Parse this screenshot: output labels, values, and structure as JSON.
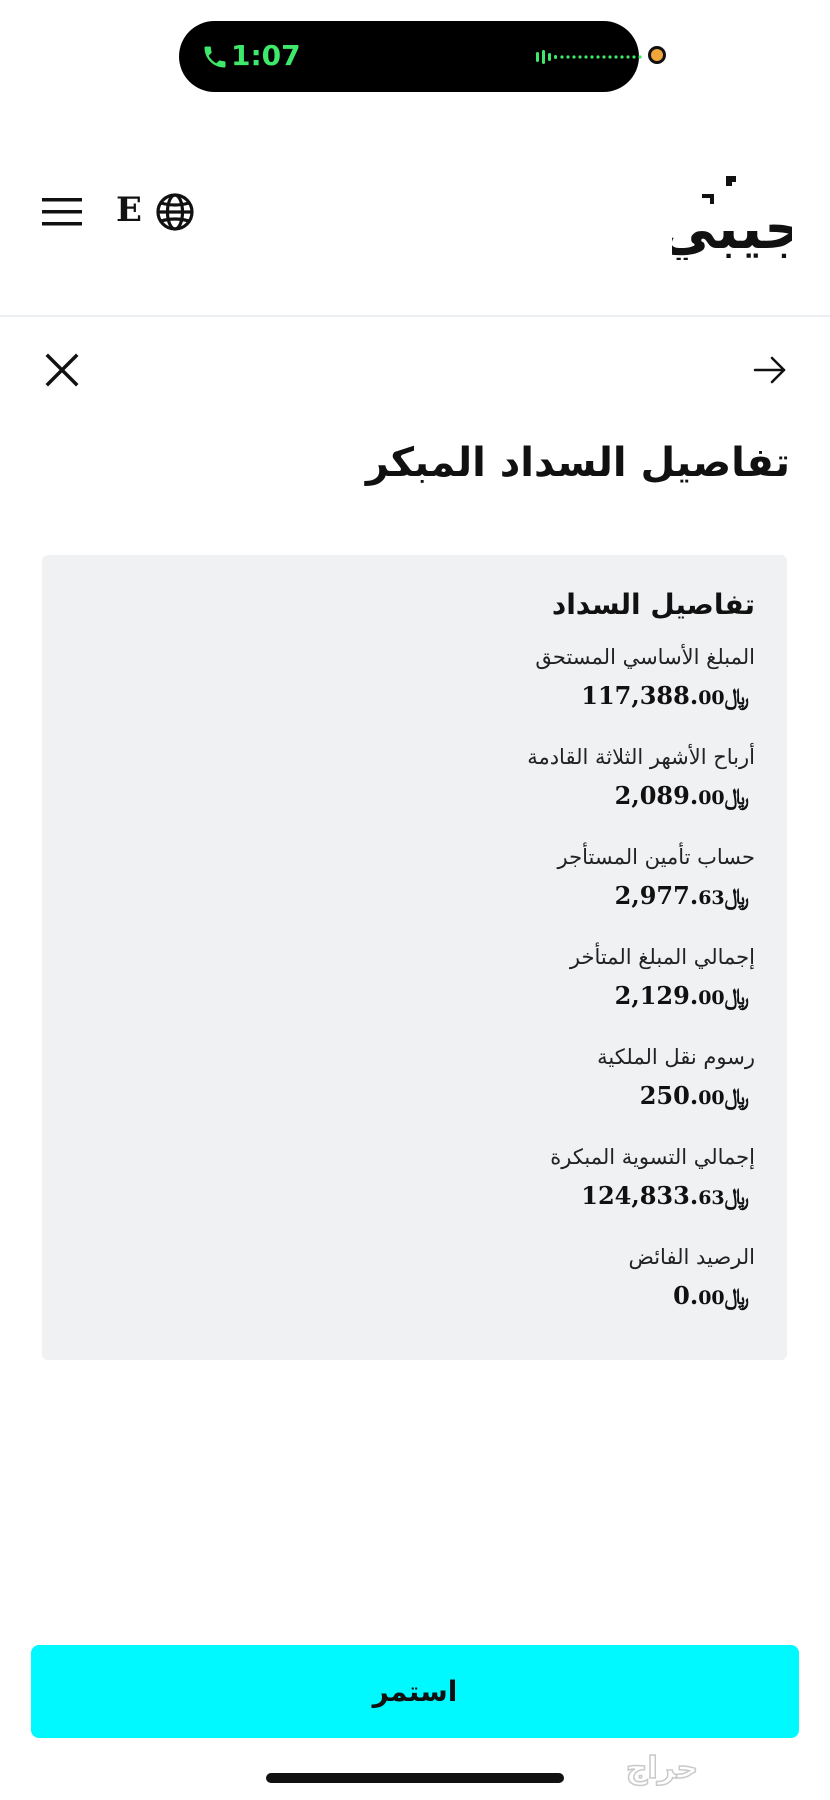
{
  "status_bar": {
    "time": "1:07"
  },
  "header": {
    "lang_letter": "E",
    "logo_text": "جيبي"
  },
  "page": {
    "title": "تفاصيل السداد المبكر"
  },
  "card": {
    "title": "تفاصيل السداد",
    "currency_symbol": "﷼",
    "items": [
      {
        "label": "المبلغ الأساسي المستحق",
        "whole": "117,388.",
        "dec": "00"
      },
      {
        "label": "أرباح الأشهر الثلاثة القادمة",
        "whole": "2,089.",
        "dec": "00"
      },
      {
        "label": "حساب تأمين المستأجر",
        "whole": "2,977.",
        "dec": "63"
      },
      {
        "label": "إجمالي المبلغ المتأخر",
        "whole": "2,129.",
        "dec": "00"
      },
      {
        "label": "رسوم نقل الملكية",
        "whole": "250.",
        "dec": "00"
      },
      {
        "label": "إجمالي التسوية المبكرة",
        "whole": "124,833.",
        "dec": "63"
      },
      {
        "label": "الرصيد الفائض",
        "whole": "0.",
        "dec": "00"
      }
    ]
  },
  "actions": {
    "continue_label": "استمر"
  },
  "watermark": {
    "text": "حراج"
  },
  "colors": {
    "accent": "#00f9ff",
    "card_bg": "#f0f1f3",
    "call_green": "#3ee86b"
  }
}
